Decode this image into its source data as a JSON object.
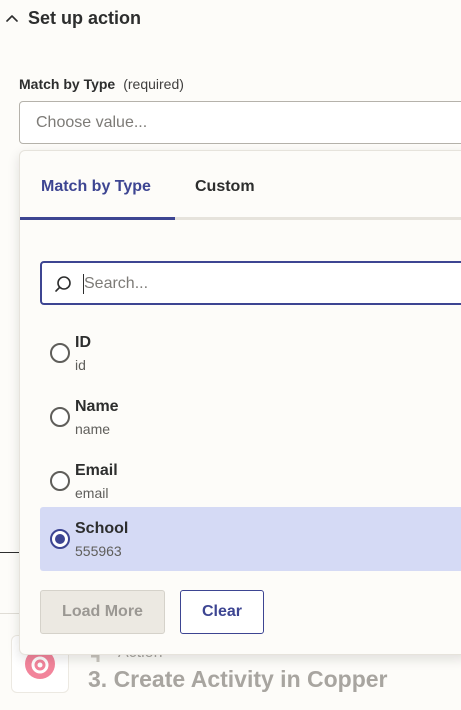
{
  "section": {
    "title": "Set up action"
  },
  "field": {
    "label": "Match by Type",
    "required": "(required)",
    "placeholder": "Choose value..."
  },
  "dropdown": {
    "tabs": [
      {
        "label": "Match by Type",
        "active": true
      },
      {
        "label": "Custom",
        "active": false
      }
    ],
    "search_placeholder": "Search...",
    "options": [
      {
        "label": "ID",
        "value": "id",
        "selected": false
      },
      {
        "label": "Name",
        "value": "name",
        "selected": false
      },
      {
        "label": "Email",
        "value": "email",
        "selected": false
      },
      {
        "label": "School",
        "value": "555963",
        "selected": true
      }
    ],
    "load_more_label": "Load More",
    "clear_label": "Clear"
  },
  "background_step": {
    "subtitle": "Action",
    "title": "3. Create Activity in Copper",
    "icon": "copper-logo-icon"
  },
  "colors": {
    "accent": "#3d4592",
    "selected_bg": "#d5daf5",
    "copper_brand": "#f06e8a"
  }
}
